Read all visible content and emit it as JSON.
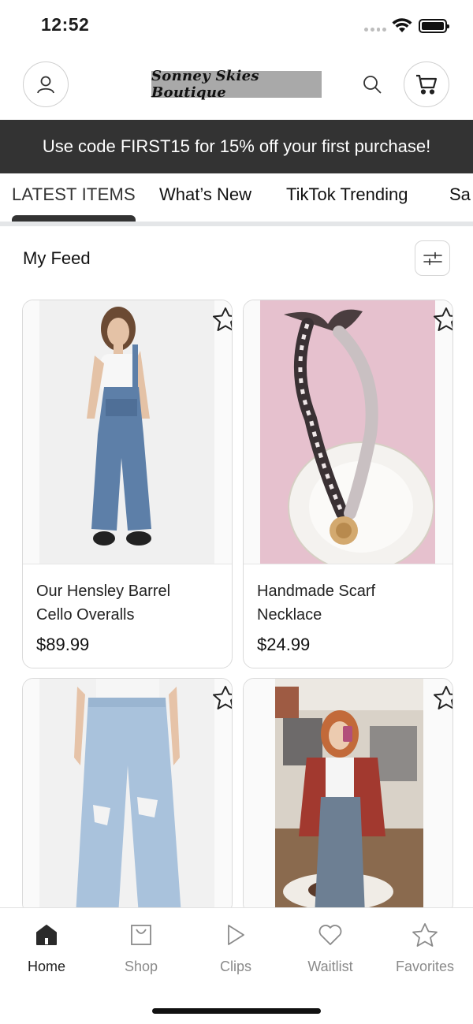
{
  "status_bar": {
    "time": "12:52"
  },
  "header": {
    "logo_text": "Sonney Skies Boutique",
    "icons": {
      "account": "user-icon",
      "search": "search-icon",
      "cart": "cart-icon"
    }
  },
  "promo": {
    "text": "Use code FIRST15 for 15% off your first purchase!"
  },
  "tabs": [
    {
      "label": "LATEST ITEMS",
      "active": true
    },
    {
      "label": "What’s New",
      "active": false
    },
    {
      "label": "TikTok Trending",
      "active": false
    },
    {
      "label": "Sa",
      "active": false
    }
  ],
  "feed": {
    "title": "My Feed",
    "filter_icon": "sliders-icon",
    "products": [
      {
        "name": "Our Hensley Barrel Cello Overalls",
        "price": "$89.99",
        "image": "overalls-photo"
      },
      {
        "name": "Handmade Scarf Necklace",
        "price": "$24.99",
        "image": "scarf-necklace-photo"
      },
      {
        "name": "",
        "price": "",
        "image": "ripped-jeans-photo"
      },
      {
        "name": "",
        "price": "",
        "image": "store-selfie-photo"
      }
    ]
  },
  "bottom_nav": [
    {
      "label": "Home",
      "icon": "home-icon",
      "active": true
    },
    {
      "label": "Shop",
      "icon": "shopping-bag-icon",
      "active": false
    },
    {
      "label": "Clips",
      "icon": "play-icon",
      "active": false
    },
    {
      "label": "Waitlist",
      "icon": "heart-icon",
      "active": false
    },
    {
      "label": "Favorites",
      "icon": "star-icon",
      "active": false
    }
  ],
  "colors": {
    "banner_bg": "#333333",
    "accent": "#333333",
    "inactive_nav": "#8a8a8a"
  }
}
